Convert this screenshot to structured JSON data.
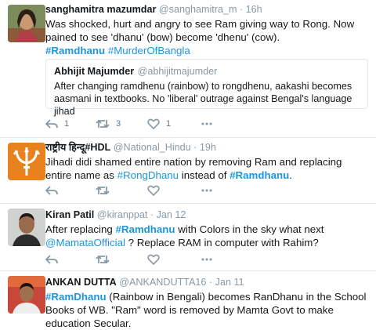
{
  "tweets": [
    {
      "name": "sanghamitra mazumdar",
      "handle": "@sanghamitra_m",
      "time": "16h",
      "text1": "Was shocked, hurt and angry to see Ram giving way to Rong. Now pained to see 'dhanu' (bow) become 'dhenu' (cow).",
      "tag1": "#Ramdhanu",
      "tag2": "#MurderOfBangla",
      "quote": {
        "name": "Abhijit Majumder",
        "handle": "@abhijitmajumder",
        "text": "After changing ramdhenu (rainbow) to rongdhenu, aakashi becomes aasmani in textbooks. No 'liberal' outrage against Bengal's language jihad"
      },
      "reply_count": "1",
      "retweet_count": "3",
      "like_count": "1"
    },
    {
      "name": "राष्ट्रीय हिन्दू#HDL",
      "handle": "@National_Hindu",
      "time": "19h",
      "text_pre": "Jihadi didi shamed entire nation by removing Ram and replacing entire name as",
      "tag1": "#RongDhanu",
      "text_mid": "instead of",
      "tag2": "#Ramdhanu",
      "text_end": "."
    },
    {
      "name": "Kiran Patil",
      "handle": "@kiranppat",
      "time": "Jan 12",
      "text_pre": "After replacing",
      "tag1": "#Ramdhanu",
      "text_mid": "with Colors in the sky what next",
      "mention": "@MamataOfficial",
      "text_end": "? Replace RAM in computer with Rahim?"
    },
    {
      "name": "ANKAN DUTTA",
      "handle": "@ANKANDUTTA16",
      "time": "Jan 11",
      "tag1": "#RamDhanu",
      "text_end": "(Rainbow in Bengali) becomes RanDhanu in the School Books of WB. \"Ram\" word is removed by Mamta Govt to make education Secular."
    }
  ],
  "separator": "·"
}
